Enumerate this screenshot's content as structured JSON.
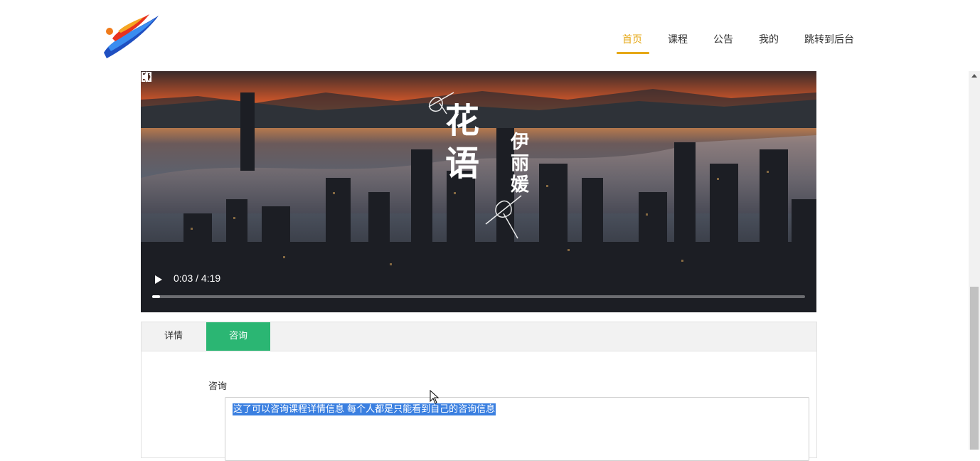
{
  "header": {
    "nav": [
      {
        "label": "首页",
        "active": true
      },
      {
        "label": "课程",
        "active": false
      },
      {
        "label": "公告",
        "active": false
      },
      {
        "label": "我的",
        "active": false
      },
      {
        "label": "跳转到后台",
        "active": false
      }
    ]
  },
  "video": {
    "time": "0:03 / 4:19",
    "progress": 0.012,
    "overlay_title": "花语",
    "overlay_subtitle": "伊丽媛",
    "icons": [
      "play-icon",
      "volume-icon",
      "fullscreen-icon",
      "more-options-icon"
    ]
  },
  "tabs": {
    "detail_label": "详情",
    "consult_label": "咨询",
    "active": "咨询"
  },
  "consult": {
    "field_label": "咨询",
    "textarea_value": "这了可以咨询课程详情信息 每个人都是只能看到自己的咨询信息"
  },
  "colors": {
    "accent": "#e6a817",
    "active_tab": "#2bb673",
    "selection": "#3a7fe0"
  }
}
